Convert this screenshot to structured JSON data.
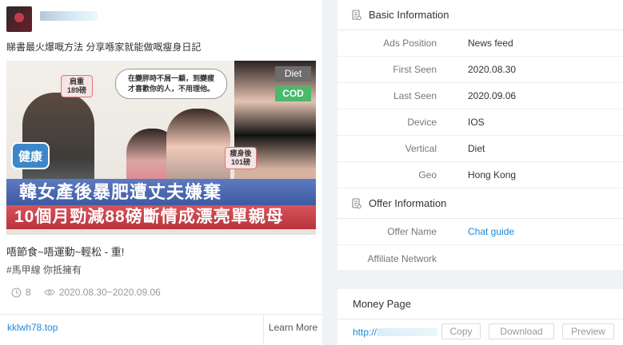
{
  "ad": {
    "text": "睇書最火爆嘅方法 分享喺家就能做嘅瘦身日記",
    "creative": {
      "ribbon_diet": "Diet",
      "ribbon_cod": "COD",
      "bubble": "在變胖時不屑一顧，到變瘦才喜歡你的人，不用理他。",
      "tag_left": "肩重189磅",
      "tag_right": "瘦身後101磅",
      "brand": "健康",
      "banner_line1": "韓女產後暴肥遭丈夫嫌棄",
      "banner_line2": "10個月勁減88磅斷情成漂亮單親母"
    },
    "description": "唔節食~唔運動~輕松 - 重!",
    "hashtags": "#馬甲線 你抵擁有",
    "stats": {
      "days": "8",
      "date_range": "2020.08.30~2020.09.06"
    },
    "footer": {
      "domain": "kklwh78.top",
      "cta": "Learn More"
    }
  },
  "basic": {
    "title": "Basic Information",
    "rows": [
      {
        "label": "Ads Position",
        "value": "News feed"
      },
      {
        "label": "First Seen",
        "value": "2020.08.30"
      },
      {
        "label": "Last Seen",
        "value": "2020.09.06"
      },
      {
        "label": "Device",
        "value": "IOS"
      },
      {
        "label": "Vertical",
        "value": "Diet"
      },
      {
        "label": "Geo",
        "value": "Hong Kong"
      }
    ]
  },
  "offer": {
    "title": "Offer Information",
    "rows": [
      {
        "label": "Offer Name",
        "value": "Chat guide"
      },
      {
        "label": "Affiliate Network",
        "value": ""
      }
    ]
  },
  "money": {
    "title": "Money Page",
    "url_prefix": "http://",
    "copy_label": "Copy",
    "download_label": "Download",
    "preview_label": "Preview"
  },
  "colors": {
    "link": "#1e88d8",
    "cod": "#4bb86b",
    "diet": "#6d6d6d"
  },
  "icons": [
    "document-icon",
    "clock-icon",
    "eye-icon"
  ]
}
